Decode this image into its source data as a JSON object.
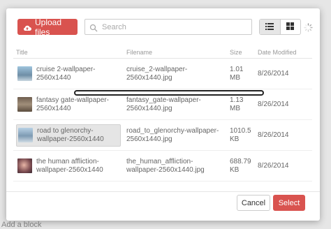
{
  "background": {
    "bottom_link": "Add a block"
  },
  "toolbar": {
    "upload_label": "Upload files",
    "search_placeholder": "Search",
    "list_view_icon": "list-icon",
    "grid_view_icon": "grid-icon"
  },
  "table": {
    "headers": [
      "Title",
      "Filename",
      "Size",
      "Date Modified"
    ],
    "rows": [
      {
        "title": "cruise 2-wallpaper-2560x1440",
        "filename": "cruise_2-wallpaper-2560x1440.jpg",
        "size": "1.01 MB",
        "date": "8/26/2014",
        "selected": false
      },
      {
        "title": "fantasy gate-wallpaper-2560x1440",
        "filename": "fantasy_gate-wallpaper-2560x1440.jpg",
        "size": "1.13 MB",
        "date": "8/26/2014",
        "selected": false
      },
      {
        "title": "road to glenorchy-wallpaper-2560x1440",
        "filename": "road_to_glenorchy-wallpaper-2560x1440.jpg",
        "size": "1010.5 KB",
        "date": "8/26/2014",
        "selected": true
      },
      {
        "title": "the human affliction-wallpaper-2560x1440",
        "filename": "the_human_affliction-wallpaper-2560x1440.jpg",
        "size": "688.79 KB",
        "date": "8/26/2014",
        "selected": false
      }
    ]
  },
  "footer": {
    "cancel_label": "Cancel",
    "select_label": "Select"
  },
  "colors": {
    "accent": "#d9534f",
    "selected_row": "#e5e5e5"
  }
}
